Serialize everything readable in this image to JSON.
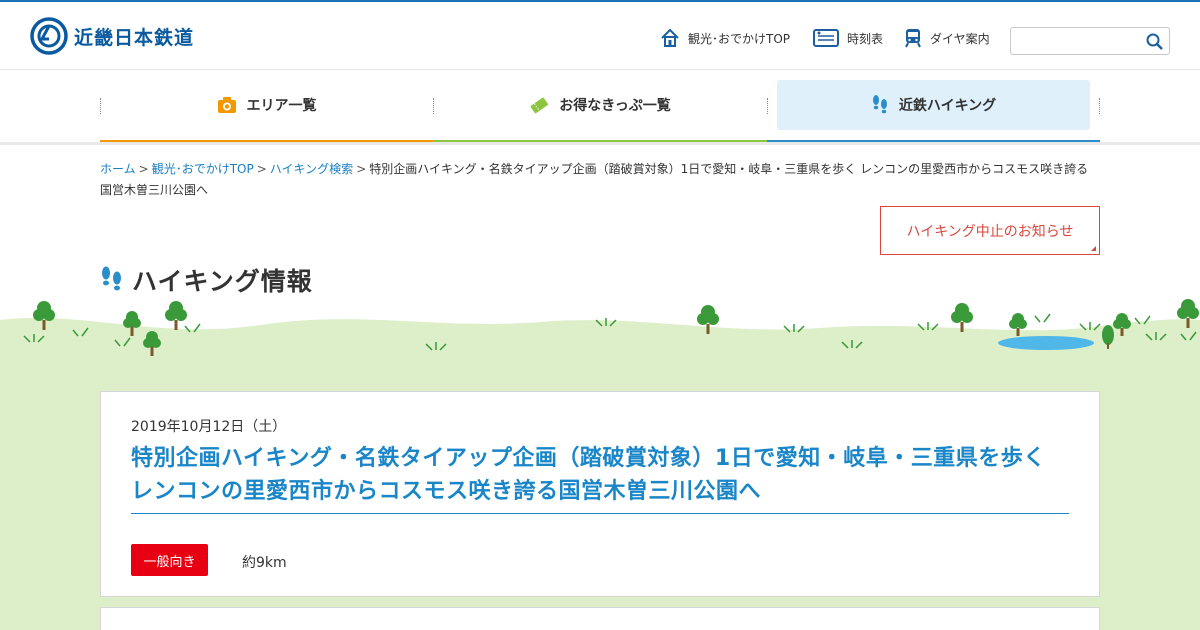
{
  "header": {
    "logo_text": "近畿日本鉄道",
    "links": [
      {
        "label": "観光･おでかけTOP",
        "icon": "home-icon"
      },
      {
        "label": "時刻表",
        "icon": "timetable-icon"
      },
      {
        "label": "ダイヤ案内",
        "icon": "train-icon"
      }
    ],
    "search_placeholder": ""
  },
  "nav": {
    "items": [
      {
        "label": "エリア一覧",
        "icon": "camera-icon",
        "color": "#f39800"
      },
      {
        "label": "お得なきっぷ一覧",
        "icon": "ticket-icon",
        "color": "#8cc63f"
      },
      {
        "label": "近鉄ハイキング",
        "icon": "footprints-icon",
        "color": "#2b8ec9",
        "active": true
      }
    ]
  },
  "breadcrumb": {
    "home": "ホーム",
    "sightseeing": "観光･おでかけTOP",
    "hiking_search": "ハイキング検索",
    "current": "特別企画ハイキング・名鉄タイアップ企画（踏破賞対象）1日で愛知・岐阜・三重県を歩く レンコンの里愛西市からコスモス咲き誇る国営木曽三川公園へ",
    "separator": ">"
  },
  "notice_button": "ハイキング中止のお知らせ",
  "page_title": "ハイキング情報",
  "event": {
    "date": "2019年10月12日（土）",
    "title": "特別企画ハイキング・名鉄タイアップ企画（踏破賞対象）1日で愛知・岐阜・三重県を歩く レンコンの里愛西市からコスモス咲き誇る国営木曽三川公園へ",
    "level": "一般向き",
    "distance": "約9km"
  },
  "colors": {
    "brand": "#0a5aa0",
    "link": "#1a7ec1",
    "accent_red": "#e60012",
    "grass": "#dcefc8"
  }
}
